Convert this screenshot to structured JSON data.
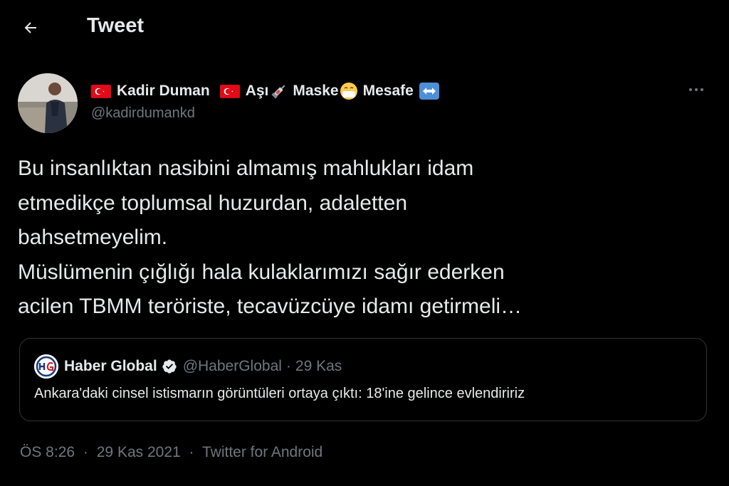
{
  "header": {
    "title": "Tweet"
  },
  "author": {
    "display_name": "Kadir Duman",
    "tag_asi": "Aşı",
    "tag_maske": "Maske",
    "tag_mesafe": "Mesafe",
    "handle": "@kadirdumankd"
  },
  "tweet": {
    "text": "Bu insanlıktan nasibini almamış mahlukları idam\netmedikçe toplumsal huzurdan, adaletten\nbahsetmeyelim.\nMüslümenin çığlığı hala kulaklarımızı sağır ederken\nacilen TBMM teröriste, tecavüzcüye idamı getirmeli…"
  },
  "quote": {
    "logo_text": "HG",
    "name": "Haber Global",
    "handle": "@HaberGlobal",
    "separator": "·",
    "date": "29 Kas",
    "text": "Ankara'daki cinsel istismarın görüntüleri ortaya çıktı: 18'ine gelince evlendiririz"
  },
  "footer": {
    "time": "ÖS 8:26",
    "sep1": "·",
    "date": "29 Kas 2021",
    "sep2": "·",
    "source": "Twitter for Android"
  },
  "colors": {
    "background": "#000000",
    "text": "#e7e9ea",
    "muted": "#71767b",
    "border": "#2f3336",
    "verified": "#1d9bf0",
    "flag_red": "#e30a17"
  },
  "icons": [
    "back-arrow-icon",
    "turkish-flag-icon",
    "syringe-icon",
    "mask-face-icon",
    "left-right-arrow-icon",
    "more-icon",
    "verified-badge-icon"
  ]
}
